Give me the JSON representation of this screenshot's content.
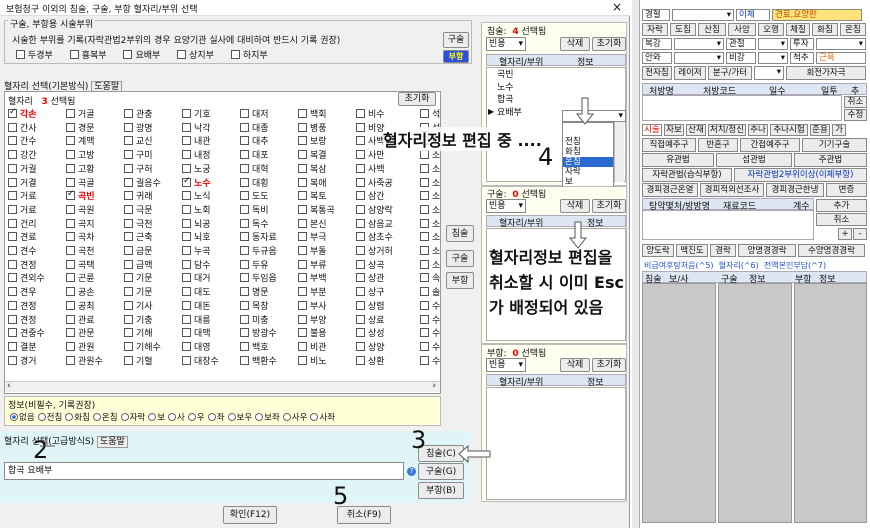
{
  "title": "보험청구 이외의 침술, 구술, 부항 혈자리/부위 선택",
  "close": "×",
  "top_group": {
    "label": "구술, 부항용 시술부위",
    "notice": "시술한 부위를 기록(자락관법2부위의 경우 요양기관 실사에 대비하여 반드시 기록 권장)",
    "items": [
      "두경부",
      "흉복부",
      "요배부",
      "상지부",
      "하지부"
    ],
    "btn_gusul": "구술",
    "btn_buhang": "부항"
  },
  "basic": {
    "label": "혈자리 선택(기본방식)",
    "help": "도움말",
    "count_label": "혈자리",
    "count_num": "3",
    "count_suffix": "선택됨",
    "reset": "초기화",
    "rows": [
      [
        "각손",
        "거골",
        "관충",
        "기호",
        "대저",
        "백회",
        "비수",
        "석"
      ],
      [
        "간사",
        "경문",
        "광명",
        "낙각",
        "대종",
        "병풍",
        "비양",
        "석"
      ],
      [
        "간수",
        "계맥",
        "교신",
        "내관",
        "대추",
        "보랑",
        "사백",
        "석"
      ],
      [
        "강간",
        "고방",
        "구미",
        "내정",
        "대포",
        "복결",
        "사만",
        "소"
      ],
      [
        "거궐",
        "고황",
        "구허",
        "노궁",
        "대혁",
        "복삼",
        "사백",
        "소"
      ],
      [
        "거결",
        "곡골",
        "궐음수",
        "노수",
        "대횡",
        "복애",
        "사죽공",
        "소"
      ],
      [
        "거료",
        "곡빈",
        "귀래",
        "노식",
        "도도",
        "복토",
        "삼간",
        "소"
      ],
      [
        "거료",
        "곡원",
        "극문",
        "노회",
        "독비",
        "복통곡",
        "삼양락",
        "소"
      ],
      [
        "건리",
        "곡지",
        "극천",
        "뇌공",
        "독수",
        "본신",
        "삼음교",
        "소"
      ],
      [
        "견료",
        "곡차",
        "근축",
        "뇌호",
        "동자료",
        "부극",
        "삼초수",
        "소"
      ],
      [
        "견수",
        "곡천",
        "금문",
        "누곡",
        "두규음",
        "부돌",
        "상거허",
        "소"
      ],
      [
        "견정",
        "곡택",
        "급맥",
        "담수",
        "두유",
        "부류",
        "상곡",
        "소"
      ],
      [
        "견외수",
        "곤륜",
        "기문",
        "대거",
        "두임읍",
        "부백",
        "상관",
        "속"
      ],
      [
        "견우",
        "공손",
        "기문",
        "대도",
        "명문",
        "부분",
        "상구",
        "솔"
      ],
      [
        "견정",
        "공최",
        "기사",
        "대돈",
        "목창",
        "부사",
        "상렴",
        "수"
      ],
      [
        "견정",
        "관료",
        "기충",
        "대릉",
        "미충",
        "부양",
        "상료",
        "수"
      ],
      [
        "견중수",
        "관문",
        "기해",
        "대맥",
        "방광수",
        "불용",
        "상성",
        "수"
      ],
      [
        "결분",
        "관원",
        "기해수",
        "대영",
        "백호",
        "비관",
        "상양",
        "수"
      ],
      [
        "경거",
        "관원수",
        "기혈",
        "대장수",
        "백환수",
        "비노",
        "상환",
        "수"
      ]
    ],
    "checked": [
      "각손",
      "곡빈",
      "노수"
    ],
    "info_label": "정보(비필수, 기록권장)",
    "info_opts": [
      "없음",
      "전침",
      "화침",
      "온침",
      "자락",
      "보",
      "사",
      "우",
      "좌",
      "보우",
      "보좌",
      "사우",
      "사좌"
    ]
  },
  "advanced": {
    "label": "혈자리 선택(고급방식S)",
    "help": "도움말",
    "input_value": "합곡 요배부",
    "btn_chim": "침술(C)",
    "btn_gu": "구술(G)",
    "btn_bu": "부항(B)"
  },
  "confirm": "확인(F12)",
  "cancel": "취소(F9)",
  "mid_buttons": {
    "chim": "침술",
    "gu": "구술",
    "bu": "부항"
  },
  "chim_panel": {
    "label": "침술:",
    "num": "4",
    "suffix": "선택됨",
    "dropdown": "빈용",
    "delete": "삭제",
    "reset": "초기화",
    "col1": "혈자리/부위",
    "col2": "정보",
    "rows": [
      "곡빈",
      "노수",
      "합곡",
      "요배부"
    ],
    "popup": [
      "전침",
      "화침",
      "온침",
      "자락",
      "보"
    ]
  },
  "gu_panel": {
    "label": "구술:",
    "num": "0",
    "suffix": "선택됨",
    "dropdown": "빈용",
    "delete": "삭제",
    "reset": "초기화",
    "col1": "혈자리/부위",
    "col2": "정보"
  },
  "bu_panel": {
    "label": "부항:",
    "num": "0",
    "suffix": "선택됨",
    "dropdown": "빈용",
    "delete": "삭제",
    "reset": "초기화",
    "col1": "혈자리/부위",
    "col2": "정보"
  },
  "annotations": {
    "edit_note": "혈자리정보 편집 중 ....",
    "cancel_note_1": "혈자리정보 편집을",
    "cancel_note_2": "취소할 시 이미 Esc",
    "cancel_note_3": "가 배정되어 있음",
    "n1": "1",
    "n2": "2",
    "n3": "3",
    "n4": "4",
    "n5": "5"
  },
  "right": {
    "r1": [
      "경혈",
      "이체",
      "견료,요양판"
    ],
    "r2": [
      "자락",
      "도침",
      "산침",
      "사암",
      "오행",
      "체질",
      "화침",
      "온침"
    ],
    "r3": [
      "복강",
      "관절",
      "투자"
    ],
    "r4": [
      "안와",
      "비강",
      "척추",
      "근육"
    ],
    "r5": [
      "전자침",
      "레이저",
      "분구/가터",
      "회전가자극"
    ],
    "hdr": [
      "처방명",
      "처방코드",
      "일수",
      "일투",
      "추가"
    ],
    "side": [
      "취소",
      "수정"
    ],
    "tabs": [
      "시술",
      "자보",
      "산재",
      "처치/정신",
      "추나",
      "추나시험",
      "준용",
      "가"
    ],
    "btns2": [
      "직접예주구",
      "반혼구",
      "간접예주구",
      "기기구술"
    ],
    "btns3": [
      "유관법",
      "섬관법",
      "주관법"
    ],
    "btns4": [
      "자락관법(습식부항)",
      "자락관법2부위이상(이체부항)"
    ],
    "btns5": [
      "경피경근온열",
      "경피적외선조사",
      "경피경근한냉",
      "변증"
    ],
    "hdr2": [
      "탕약몇처/방방명",
      "재료코드",
      "계수"
    ],
    "side2": [
      "추가",
      "취소",
      "+",
      "-"
    ],
    "tabs2": [
      "양도락",
      "맥진도",
      "경락",
      "양명경경락",
      "수양명경경락"
    ],
    "status": [
      "비급여후탕처음(^5)",
      "혈자리(^6)",
      "전액본인부담(^7)"
    ],
    "hdr3": [
      "침술",
      "보/사",
      "구술",
      "정보",
      "부항",
      "정보"
    ]
  }
}
